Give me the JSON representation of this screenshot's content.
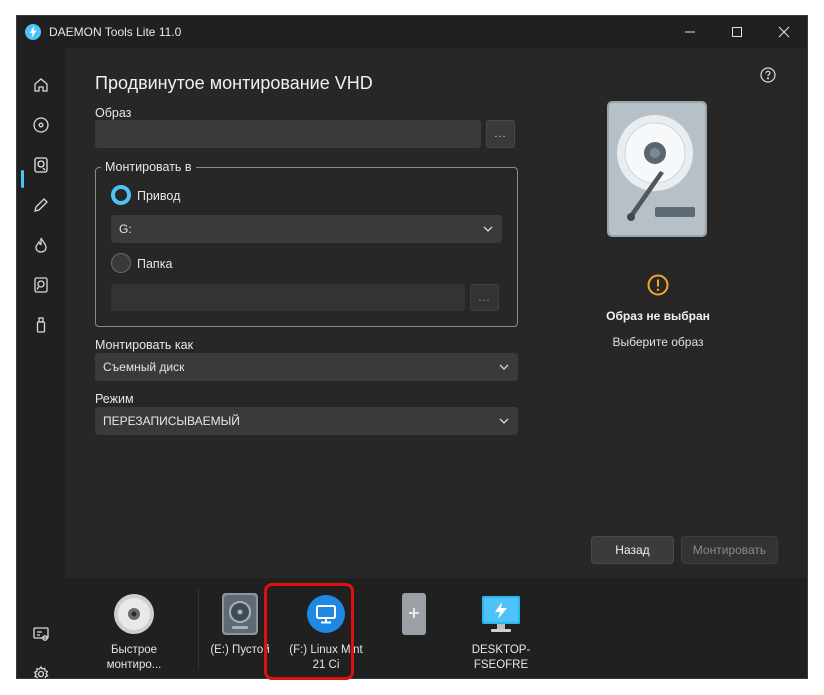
{
  "window": {
    "title": "DAEMON Tools Lite 11.0"
  },
  "nav": {
    "items": [
      {
        "icon": "home-icon"
      },
      {
        "icon": "disc-icon"
      },
      {
        "icon": "image-mount-icon"
      },
      {
        "icon": "edit-icon"
      },
      {
        "icon": "burn-icon"
      },
      {
        "icon": "disk-search-icon"
      },
      {
        "icon": "usb-icon"
      }
    ],
    "bottom": [
      {
        "icon": "license-icon"
      },
      {
        "icon": "settings-icon"
      }
    ]
  },
  "main": {
    "page_title": "Продвинутое монтирование VHD",
    "image_label": "Образ",
    "image_value": "",
    "browse": "...",
    "mount_to_label": "Монтировать в",
    "drive_option": "Привод",
    "drive_value": "G:",
    "folder_option": "Папка",
    "folder_value": "",
    "mount_as_label": "Монтировать как",
    "mount_as_value": "Съемный диск",
    "mode_label": "Режим",
    "mode_value": "ПЕРЕЗАПИСЫВАЕМЫЙ"
  },
  "info": {
    "no_image": "Образ не выбран",
    "choose_image": "Выберите образ"
  },
  "buttons": {
    "back": "Назад",
    "mount": "Монтировать"
  },
  "tray": {
    "items": [
      {
        "label": "Быстрое монтиро...",
        "icon": "quick-mount-icon"
      },
      {
        "label": "(E:) Пустой",
        "icon": "empty-drive-icon"
      },
      {
        "label": "(F:) Linux Mint 21 Ci",
        "icon": "monitor-drive-icon"
      },
      {
        "label": "",
        "icon": "add-drive-icon"
      },
      {
        "label": "DESKTOP-FSEOFRE",
        "icon": "desktop-computer-icon"
      }
    ]
  },
  "colors": {
    "accent": "#4fc3f7",
    "warning": "#f5a623",
    "highlight": "#e01010"
  }
}
